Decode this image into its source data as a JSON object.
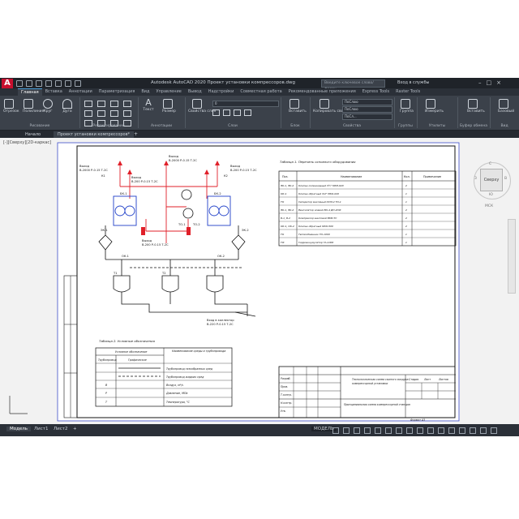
{
  "window": {
    "title": "Autodesk AutoCAD 2020   Проект установки компрессоров.dwg",
    "search_placeholder": "Введите ключевое слово/фразу",
    "sign_in": "Вход в службы",
    "logo": "A"
  },
  "ribbon_tabs": [
    "Главная",
    "Вставка",
    "Аннотации",
    "Параметризация",
    "Вид",
    "Управление",
    "Вывод",
    "Надстройки",
    "Совместная работа",
    "Рекомендованные приложения",
    "Express Tools",
    "Raster Tools"
  ],
  "active_tab": "Главная",
  "ribbon": {
    "tools": [
      "Отрезок",
      "Полилиния",
      "Круг",
      "Дуга",
      "Текст",
      "Размер",
      "Свойства слоя",
      "Вставить",
      "Копировать свойства",
      "Группа",
      "Измерить",
      "Вставить",
      "Базовый"
    ],
    "dropdowns": {
      "layer": "0",
      "color": "ПоСлою",
      "linetype": "ПоСлою",
      "lineweight": "ПоСл..."
    },
    "panels": [
      "Рисование",
      "Редактирование",
      "Аннотации",
      "Слои",
      "Блок",
      "Свойства",
      "Группы",
      "Утилиты",
      "Буфер обмена",
      "Вид"
    ]
  },
  "doc_tabs": [
    "Начало",
    "Проект установки компрессоров*"
  ],
  "viewport_label": "[-][Сверху][2D-каркас]",
  "viewcube": {
    "face": "Сверху",
    "north": "С",
    "south": "Ю",
    "west": "З",
    "east": "В",
    "wcs": "МСК"
  },
  "drawing": {
    "labels": {
      "out1": "Выход",
      "out1_spec": "В-2000 Р-0.15 Т-2С",
      "out2": "Выход",
      "out2_spec": "В-2000 Р-0.15 Т-2С",
      "out3": "Выход",
      "out3_spec": "В-200 Р-0.15 Т-2С",
      "out4": "Выход",
      "out4_spec": "В-200 Р-0.15 Т-2С",
      "out5": "Выход",
      "out5_spec": "В-200 Р-0.15 Т-2С",
      "inlet": "Вход в коллектор",
      "inlet_spec": "В-220 Р-0.15 Т-2С",
      "tags": [
        "БК-1",
        "БК-2",
        "ТО-1",
        "ТО-2",
        "ЭК-1",
        "ЭК-2",
        "ОК-1",
        "ОК-2",
        "Т1",
        "Т2",
        "К1",
        "К2"
      ]
    },
    "table1": {
      "title": "Таблица 1. Перечень основного оборудования",
      "headers": [
        "Поз.",
        "Наименование",
        "Кол.",
        "Примечание"
      ],
      "rows": [
        [
          "ЭК-1, ЭК-2",
          "Клапан соленоидный 3½\" МКЭ-020",
          "2",
          ""
        ],
        [
          "ОК-1",
          "Клапан обратный 3/4\" МКО-020",
          "1",
          ""
        ],
        [
          "ТО",
          "Сепаратор масляный ОСМ-4 ТО-1",
          "1",
          ""
        ],
        [
          "ЭК-1, ЭК-2",
          "Вентилятор осевой ВО-4 ДН-2ОФ",
          "2",
          ""
        ],
        [
          "Б-1, Б-2",
          "Компрессор винтовой ВКМ-ТС",
          "2",
          ""
        ],
        [
          "ОК-1, ОК-2",
          "Клапан обратный ФКО-500",
          "2",
          ""
        ],
        [
          "ТО",
          "Теплообменник ТО-1000",
          "1",
          ""
        ],
        [
          "ТФ",
          "Гидроаккумулятор ГА-1000",
          "1",
          ""
        ]
      ]
    },
    "table2": {
      "title": "Таблица 2. Условные обозначения",
      "col1": "Условное обозначение",
      "col2": "Наименование среды и трубопровода",
      "sub1": "Трубопровод",
      "sub2": "Графическое",
      "rows": [
        [
          "",
          "",
          "Трубопровод газообразных сред"
        ],
        [
          "",
          "",
          "Трубопровод жидких сред"
        ],
        [
          "В",
          "",
          "Воздух, м³/ч"
        ],
        [
          "Р",
          "",
          "Давление, МПа"
        ],
        [
          "Т",
          "",
          "Температура, °С"
        ]
      ]
    },
    "stamp": {
      "title1": "Технологическая схема сжатого воздуха",
      "title2": "компрессорной установки",
      "title3": "Принципиальная схема компрессорной станции",
      "rows": [
        "Разраб.",
        "Пров.",
        "Т.контр.",
        "Н.контр.",
        "Утв."
      ],
      "sheet": "Лист",
      "sheets": "Листов",
      "stage": "Стадия",
      "format": "Формат А3"
    }
  },
  "status": {
    "layouts": [
      "Модель",
      "Лист1",
      "Лист2"
    ],
    "model_label": "МОДЕЛЬ"
  }
}
